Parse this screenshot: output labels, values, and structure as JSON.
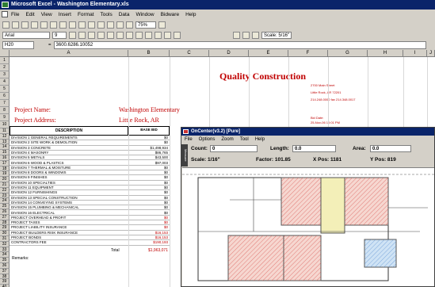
{
  "window": {
    "title": "Microsoft Excel - Washington Elementary.xls"
  },
  "menu": [
    "File",
    "Edit",
    "View",
    "Insert",
    "Format",
    "Tools",
    "Data",
    "Window",
    "Bidware",
    "Help"
  ],
  "font": {
    "name": "Arial",
    "size": "9",
    "zoom": "75%",
    "scale": "Scale: 5/16\""
  },
  "formula": {
    "cell": "H20",
    "fx": "=",
    "value": "3600.6286.10052"
  },
  "columns": [
    "A",
    "B",
    "C",
    "D",
    "E",
    "F",
    "G",
    "H",
    "I",
    "J"
  ],
  "header": {
    "company": "Quality Construction",
    "address": [
      "2700 Main Street",
      "Little Rock, AR 72201",
      "214.248.0000  fax 214.348.0017"
    ],
    "project_label": "Project Name:",
    "project_value": "Washington Elementary",
    "address_label": "Project Address:",
    "address_value": "Little Rock, AR",
    "bid_date": "Bid Date:",
    "bid_value": "25-Nov-06  10:01 PM"
  },
  "table": {
    "col_desc": "DESCRIPTION",
    "col_base": "BASE BID",
    "rows": [
      {
        "d": "DIVISION 1 GENERAL REQUIREMENTS",
        "v": "$0"
      },
      {
        "d": "DIVISION 2 SITE WORK & DEMOLITION",
        "v": "$0"
      },
      {
        "d": "DIVISION 3 CONCRETE",
        "v": "$1,498,934"
      },
      {
        "d": "DIVISION 4 MASONRY",
        "v": "$86,765"
      },
      {
        "d": "DIVISION 5 METALS",
        "v": "$43,500"
      },
      {
        "d": "DIVISION 6 WOOD & PLASTICS",
        "v": "$97,003"
      },
      {
        "d": "DIVISION 7 THERMAL & MOISTURE",
        "v": "$0"
      },
      {
        "d": "DIVISION 8 DOORS & WINDOWS",
        "v": "$0"
      },
      {
        "d": "DIVISION 9 FINISHES",
        "v": "$0"
      },
      {
        "d": "DIVISION 10 SPECIALTIES",
        "v": "$0"
      },
      {
        "d": "DIVISION 11 EQUIPMENT",
        "v": "$0"
      },
      {
        "d": "DIVISION 12 FURNISHINGS",
        "v": "$0"
      },
      {
        "d": "DIVISION 13 SPECIAL CONSTRUCTION",
        "v": "$0"
      },
      {
        "d": "DIVISION 14 CONVEYING SYSTEMS",
        "v": "$0"
      },
      {
        "d": "DIVISION 15 PLUMBING & MECHANICAL",
        "v": "$0"
      },
      {
        "d": "DIVISION 16 ELECTRICAL",
        "v": "$0"
      },
      {
        "d": "PROJECT OVERHEAD & PROFIT",
        "v": "$0"
      },
      {
        "d": "PROJECT TAXES",
        "v": "$0"
      },
      {
        "d": "PROJECT LIABILITY INSURANCE",
        "v": "$0"
      },
      {
        "d": "PROJECT BUILDERS RISK INSURANCE",
        "v": "$16,153"
      },
      {
        "d": "PROJECT BONDS",
        "v": "$16,153"
      },
      {
        "d": "CONTRACTORS FEE",
        "v": "$190,193"
      }
    ],
    "total_label": "Total",
    "total_value": "$1,963,071",
    "remarks": "Remarks:"
  },
  "oncenter": {
    "title": "OnCenter(v3.2) [Pure]",
    "menu": [
      "File",
      "Options",
      "Zoom",
      "Tool",
      "Help"
    ],
    "count_label": "Count:",
    "count_value": "0",
    "length_label": "Length:",
    "length_value": "0.0",
    "area_label": "Area:",
    "area_value": "0.0",
    "scale_label": "Scale: 1/16\"",
    "factor_label": "Factor: 101.85",
    "xpos_label": "X Pos: 1181",
    "ypos_label": "Y Pos: 819",
    "side_strip": "Measure"
  },
  "colors": {
    "accent": "#0a246a",
    "red": "#c00000"
  }
}
